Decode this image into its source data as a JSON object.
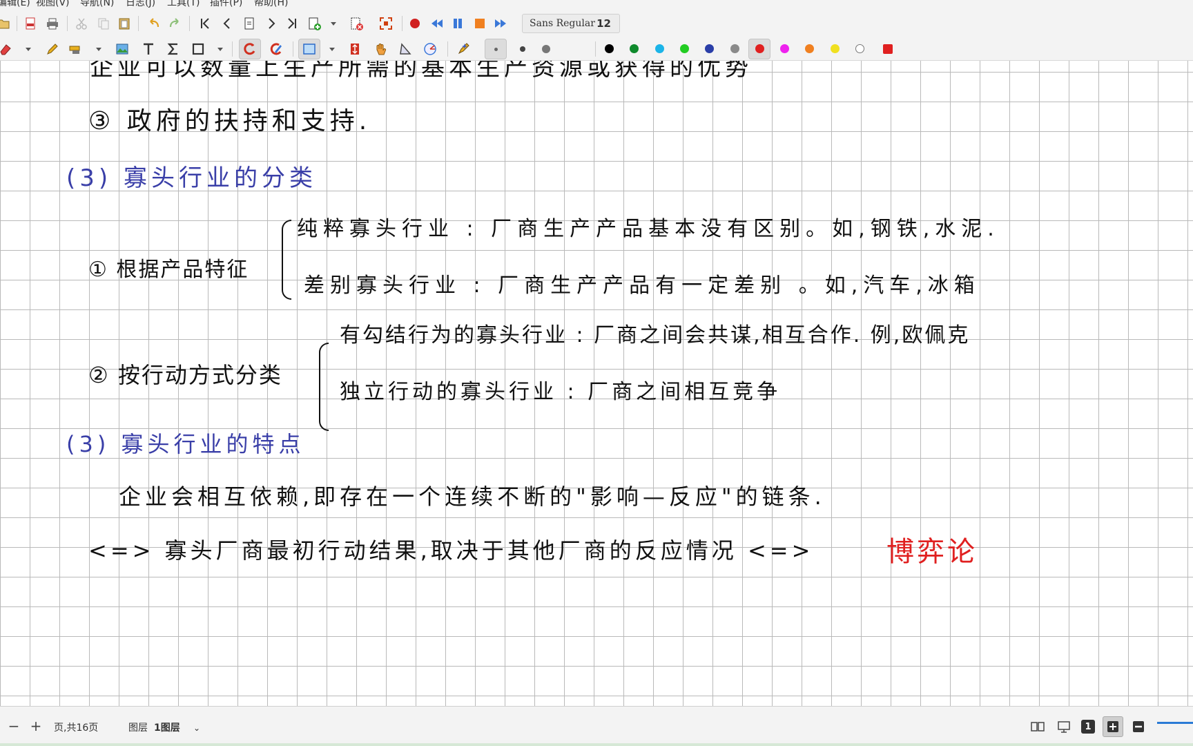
{
  "menu": [
    "编辑(E)",
    "视图(V)",
    "导航(N)",
    "日志(J)",
    "工具(T)",
    "插件(P)",
    "帮助(H)"
  ],
  "toolbar": {
    "font_name": "Sans Regular",
    "font_size": "12",
    "colors": [
      "#000000",
      "#0f8a2c",
      "#1bb4e8",
      "#22cc22",
      "#2a3ea8",
      "#8a8a8a",
      "#e02020",
      "#ee22ee",
      "#f08020",
      "#f0e020",
      "#ffffff"
    ],
    "selected_color": "#e02020"
  },
  "note": {
    "line_top": "企业可以数量上生产所需的基本生产资源或获得的优势",
    "line_3": "③ 政府的扶持和支持.",
    "heading_classification": "(3) 寡头行业的分类",
    "item1_label": "① 根据产品特征",
    "item1_a": "纯粹寡头行业 : 厂商生产产品基本没有区别。如,钢铁,水泥.",
    "item1_b": "差别寡头行业 : 厂商生产产品有一定差别 。如,汽车,冰箱",
    "item2_label": "② 按行动方式分类",
    "item2_a": "有勾结行为的寡头行业 : 厂商之间会共谋,相互合作. 例,欧佩克",
    "item2_b": "独立行动的寡头行业 : 厂商之间相互竞争",
    "heading_features": "(3) 寡头行业的特点",
    "features_line": "企业会相互依赖,即存在一个连续不断的\"影响—反应\"的链条.",
    "result_prefix": "<=> 寡头厂商最初行动结果,取决于其他厂商的反应情况 <=>",
    "result_highlight": "博弈论"
  },
  "status": {
    "page_info": "页,共16页",
    "layer_prefix": "图层",
    "layer_name": "1图层",
    "page_num_badge": "1"
  }
}
